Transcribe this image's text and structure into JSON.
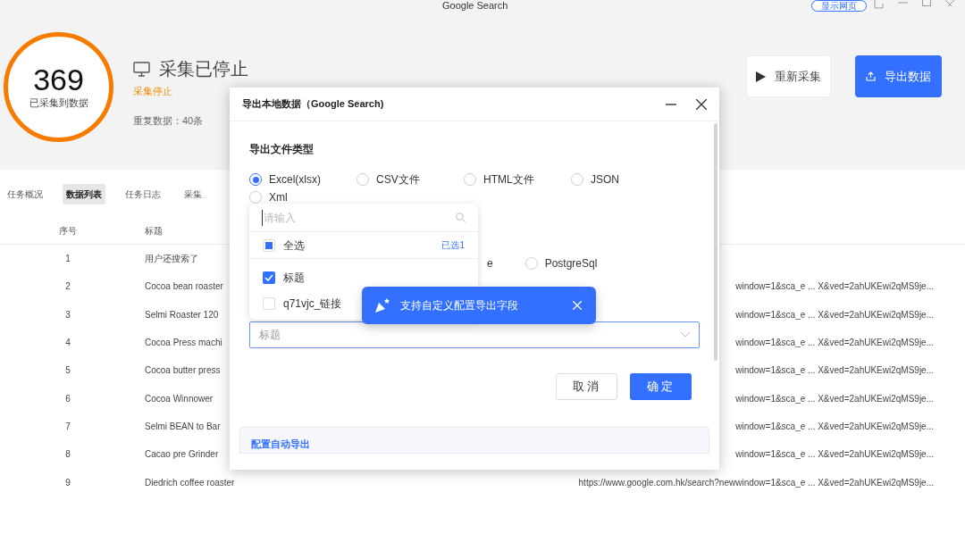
{
  "window": {
    "title": "Google Search",
    "show_page_button": "显示网页"
  },
  "summary": {
    "count": "369",
    "count_label": "已采集到数据",
    "status": "采集已停止",
    "status_note": "采集停止",
    "duplicates": "重复数据：40条"
  },
  "actions": [
    {
      "label": "重新采集",
      "kind": "restart"
    },
    {
      "label": "导出数据",
      "kind": "export"
    }
  ],
  "tabs": [
    {
      "label": "任务概况",
      "selected": false
    },
    {
      "label": "数据列表",
      "selected": true
    },
    {
      "label": "任务日志",
      "selected": false
    },
    {
      "label": "采集",
      "selected": false
    }
  ],
  "table": {
    "columns": [
      "序号",
      "标题"
    ],
    "rows": [
      {
        "index": "1",
        "title": "用户还搜索了",
        "column_3": ""
      },
      {
        "index": "2",
        "title": "Cocoa bean roaster",
        "column_3": "window=1&sca_e ... X&ved=2ahUKEwi2qMS9je..."
      },
      {
        "index": "3",
        "title": "Selmi Roaster 120",
        "column_3": "window=1&sca_e ... X&ved=2ahUKEwi2qMS9je..."
      },
      {
        "index": "4",
        "title": "Cocoa Press machi",
        "column_3": "window=1&sca_e ... X&ved=2ahUKEwi2qMS9je..."
      },
      {
        "index": "5",
        "title": "Cocoa butter press",
        "column_3": "window=1&sca_e ... X&ved=2ahUKEwi2qMS9je..."
      },
      {
        "index": "6",
        "title": "Cocoa Winnower",
        "column_3": "window=1&sca_e ... X&ved=2ahUKEwi2qMS9je..."
      },
      {
        "index": "7",
        "title": "Selmi BEAN to Bar",
        "column_3": "window=1&sca_e ... X&ved=2ahUKEwi2qMS9je..."
      },
      {
        "index": "8",
        "title": "Cacao pre Grinder",
        "column_3": "window=1&sca_e ... X&ved=2ahUKEwi2qMS9je..."
      },
      {
        "index": "9",
        "title": "Diedrich coffee roaster",
        "column_3": "https://www.google.com.hk/search?newwindow=1&sca_e ... X&ved=2ahUKEwi2qMS9je..."
      }
    ]
  },
  "dialog": {
    "title": "导出本地数据（Google Search)",
    "section": "导出文件类型",
    "file_types": [
      {
        "label": "Excel(xlsx)",
        "selected": true
      },
      {
        "label": "CSV文件",
        "selected": false
      },
      {
        "label": "HTML文件",
        "selected": false
      },
      {
        "label": "JSON",
        "selected": false
      },
      {
        "label": "Xml",
        "selected": false
      }
    ],
    "hidden_option_fragment": "e",
    "database_option": {
      "label": "PostgreSql",
      "selected": false
    },
    "field_picker": {
      "search_placeholder": "请输入",
      "select_all": {
        "label": "全选",
        "checked": false,
        "indeterminate": true
      },
      "selected_count": "已选1",
      "fields": [
        {
          "label": "标题",
          "checked": true
        },
        {
          "label": "q71vjc_链接",
          "checked": false
        }
      ]
    },
    "tooltip": "支持自定义配置导出字段",
    "field_select_value": "标题",
    "buttons": [
      {
        "label": "取消",
        "kind": "secondary"
      },
      {
        "label": "确定",
        "kind": "primary"
      }
    ],
    "auto_export": "配置自动导出"
  }
}
